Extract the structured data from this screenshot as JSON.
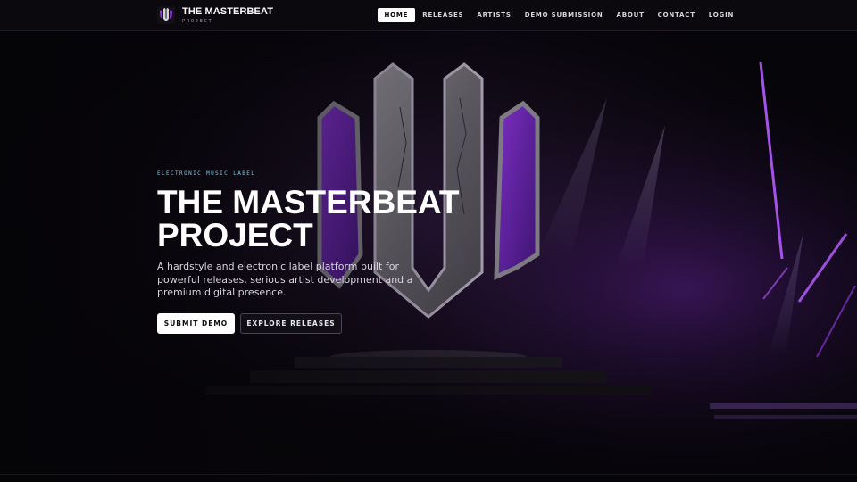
{
  "brand": {
    "title": "THE MASTERBEAT",
    "subtitle": "PROJECT",
    "logo": "masterbeat-logo-icon"
  },
  "nav": {
    "items": [
      {
        "label": "HOME",
        "active": true
      },
      {
        "label": "RELEASES",
        "active": false
      },
      {
        "label": "ARTISTS",
        "active": false
      },
      {
        "label": "DEMO SUBMISSION",
        "active": false
      },
      {
        "label": "ABOUT",
        "active": false
      },
      {
        "label": "CONTACT",
        "active": false
      },
      {
        "label": "LOGIN",
        "active": false
      }
    ]
  },
  "hero": {
    "eyebrow": "ELECTRONIC MUSIC LABEL",
    "title_line1": "THE MASTERBEAT",
    "title_line2": "PROJECT",
    "tagline": "A hardstyle and electronic label platform built for powerful releases, serious artist development and a premium digital presence.",
    "primary_button": "SUBMIT DEMO",
    "secondary_button": "EXPLORE RELEASES"
  },
  "colors": {
    "accent": "#8a2be2",
    "eyebrow": "#6fd3e6",
    "background": "#050407"
  }
}
